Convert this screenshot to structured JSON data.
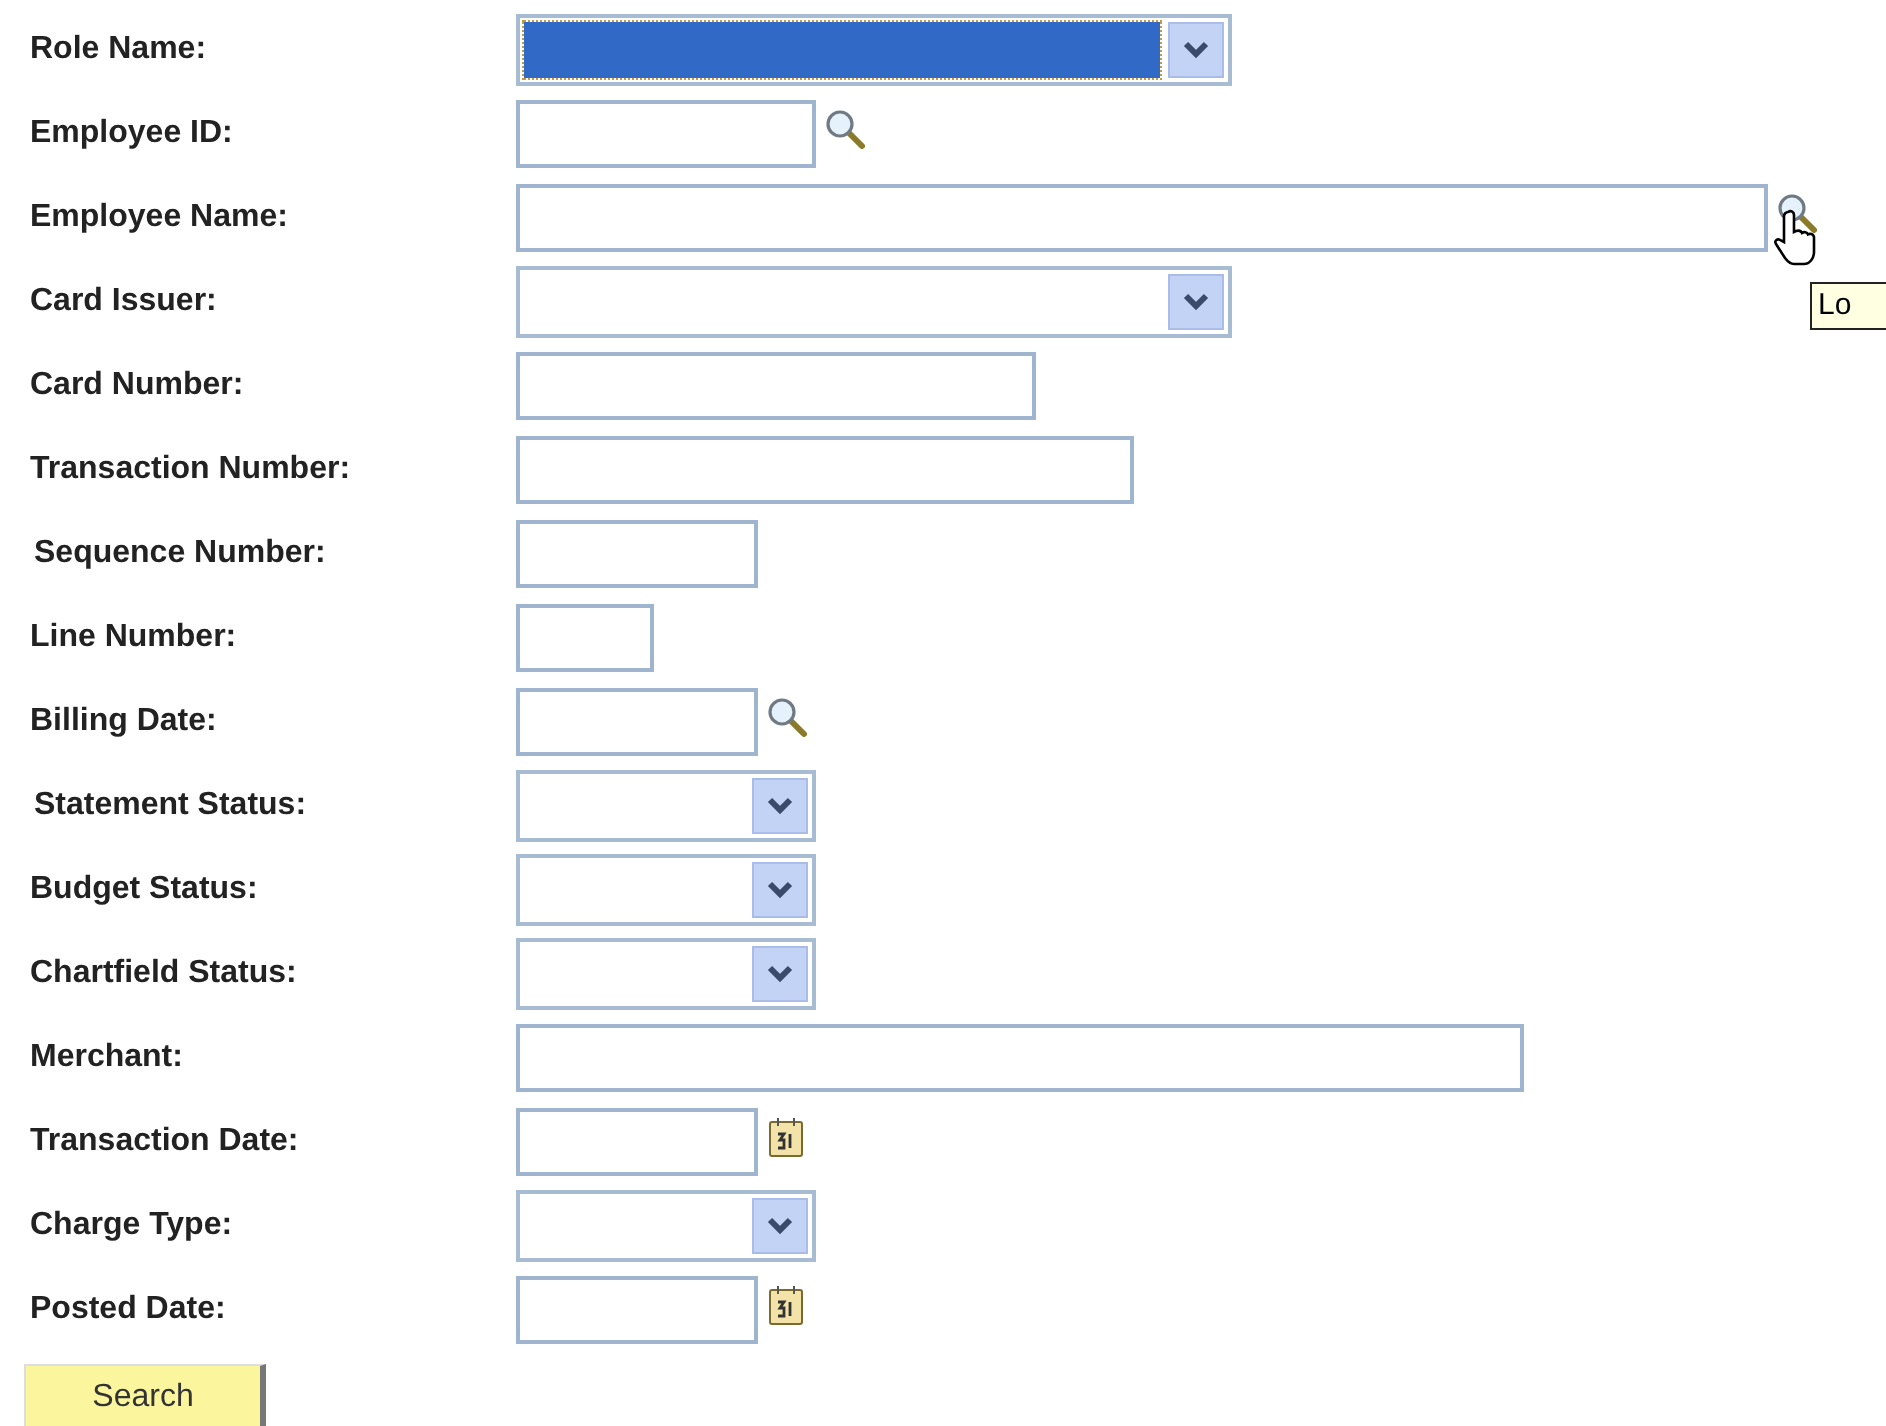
{
  "fields": [
    {
      "label": "Role Name:",
      "kind": "select",
      "highlighted": true
    },
    {
      "label": "Employee ID:",
      "kind": "lookup"
    },
    {
      "label": "Employee Name:",
      "kind": "lookup",
      "hovered": true
    },
    {
      "label": "Card Issuer:",
      "kind": "select",
      "highlighted": false
    },
    {
      "label": "Card Number:",
      "kind": "text"
    },
    {
      "label": "Transaction Number:",
      "kind": "text"
    },
    {
      "label": "Sequence Number:",
      "kind": "text"
    },
    {
      "label": "Line Number:",
      "kind": "text"
    },
    {
      "label": "Billing Date:",
      "kind": "lookup"
    },
    {
      "label": "Statement Status:",
      "kind": "select",
      "highlighted": false
    },
    {
      "label": "Budget Status:",
      "kind": "select",
      "highlighted": false
    },
    {
      "label": "Chartfield Status:",
      "kind": "select",
      "highlighted": false
    },
    {
      "label": "Merchant:",
      "kind": "text"
    },
    {
      "label": "Transaction Date:",
      "kind": "date"
    },
    {
      "label": "Charge Type:",
      "kind": "select",
      "highlighted": false
    },
    {
      "label": "Posted Date:",
      "kind": "date"
    }
  ],
  "tooltip": {
    "text": "Lo"
  },
  "search_button": {
    "label": "Search"
  }
}
